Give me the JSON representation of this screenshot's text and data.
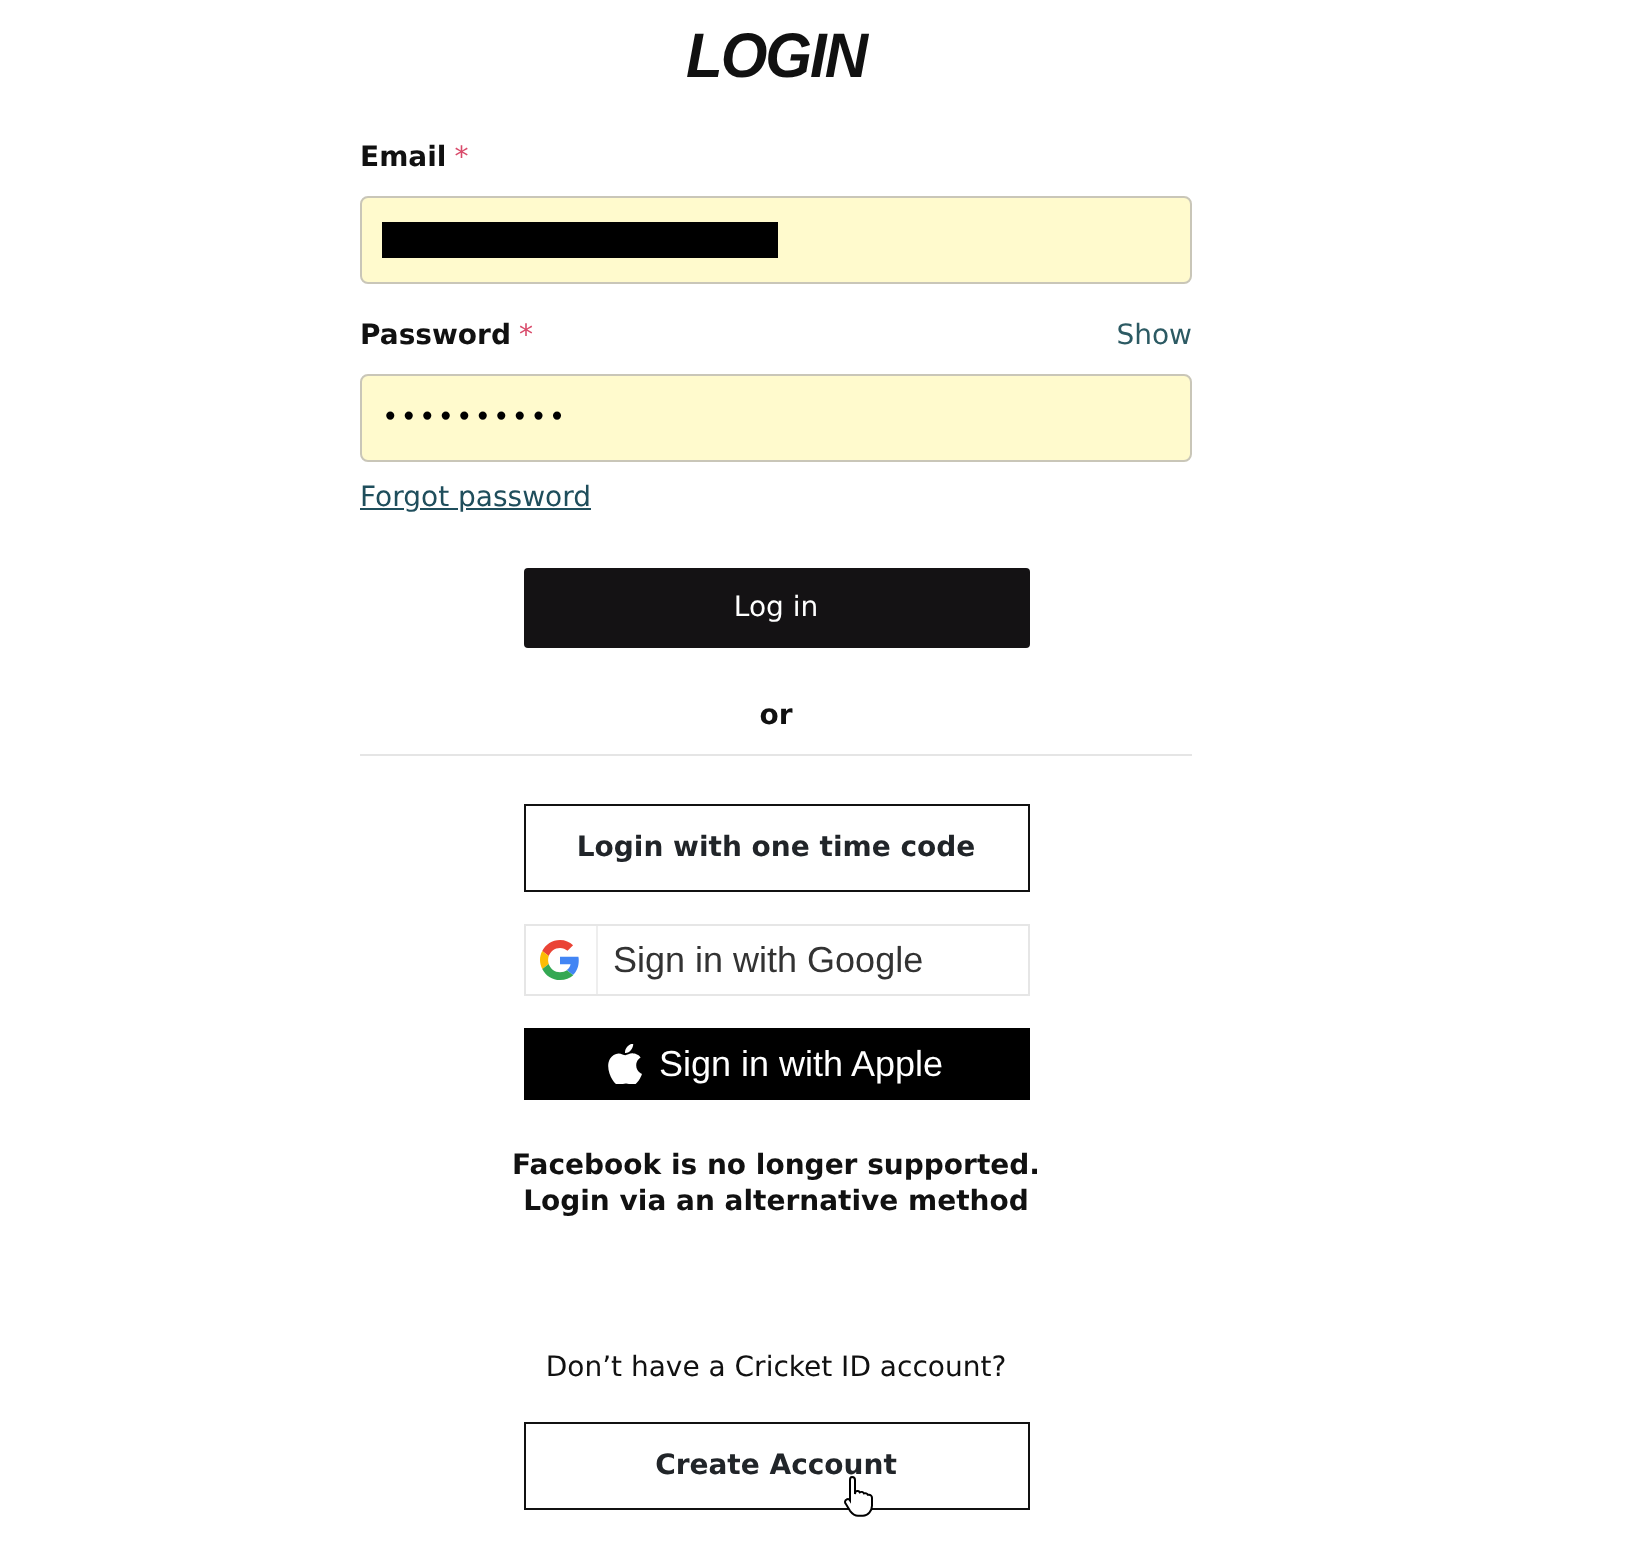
{
  "title": "LOGIN",
  "email": {
    "label": "Email",
    "required_mark": "*",
    "redacted": true
  },
  "password": {
    "label": "Password",
    "required_mark": "*",
    "toggle": "Show",
    "value": "••••••••••"
  },
  "forgot_link": "Forgot password",
  "login_button": "Log in",
  "divider_text": "or",
  "one_time_code_button": "Login with one time code",
  "google_button": "Sign in with Google",
  "apple_button": "Sign in with Apple",
  "facebook_notice": [
    "Facebook is no longer supported.",
    "Login via an alternative method"
  ],
  "signup_prompt": "Don’t have a Cricket ID account?",
  "create_account_button": "Create Account"
}
